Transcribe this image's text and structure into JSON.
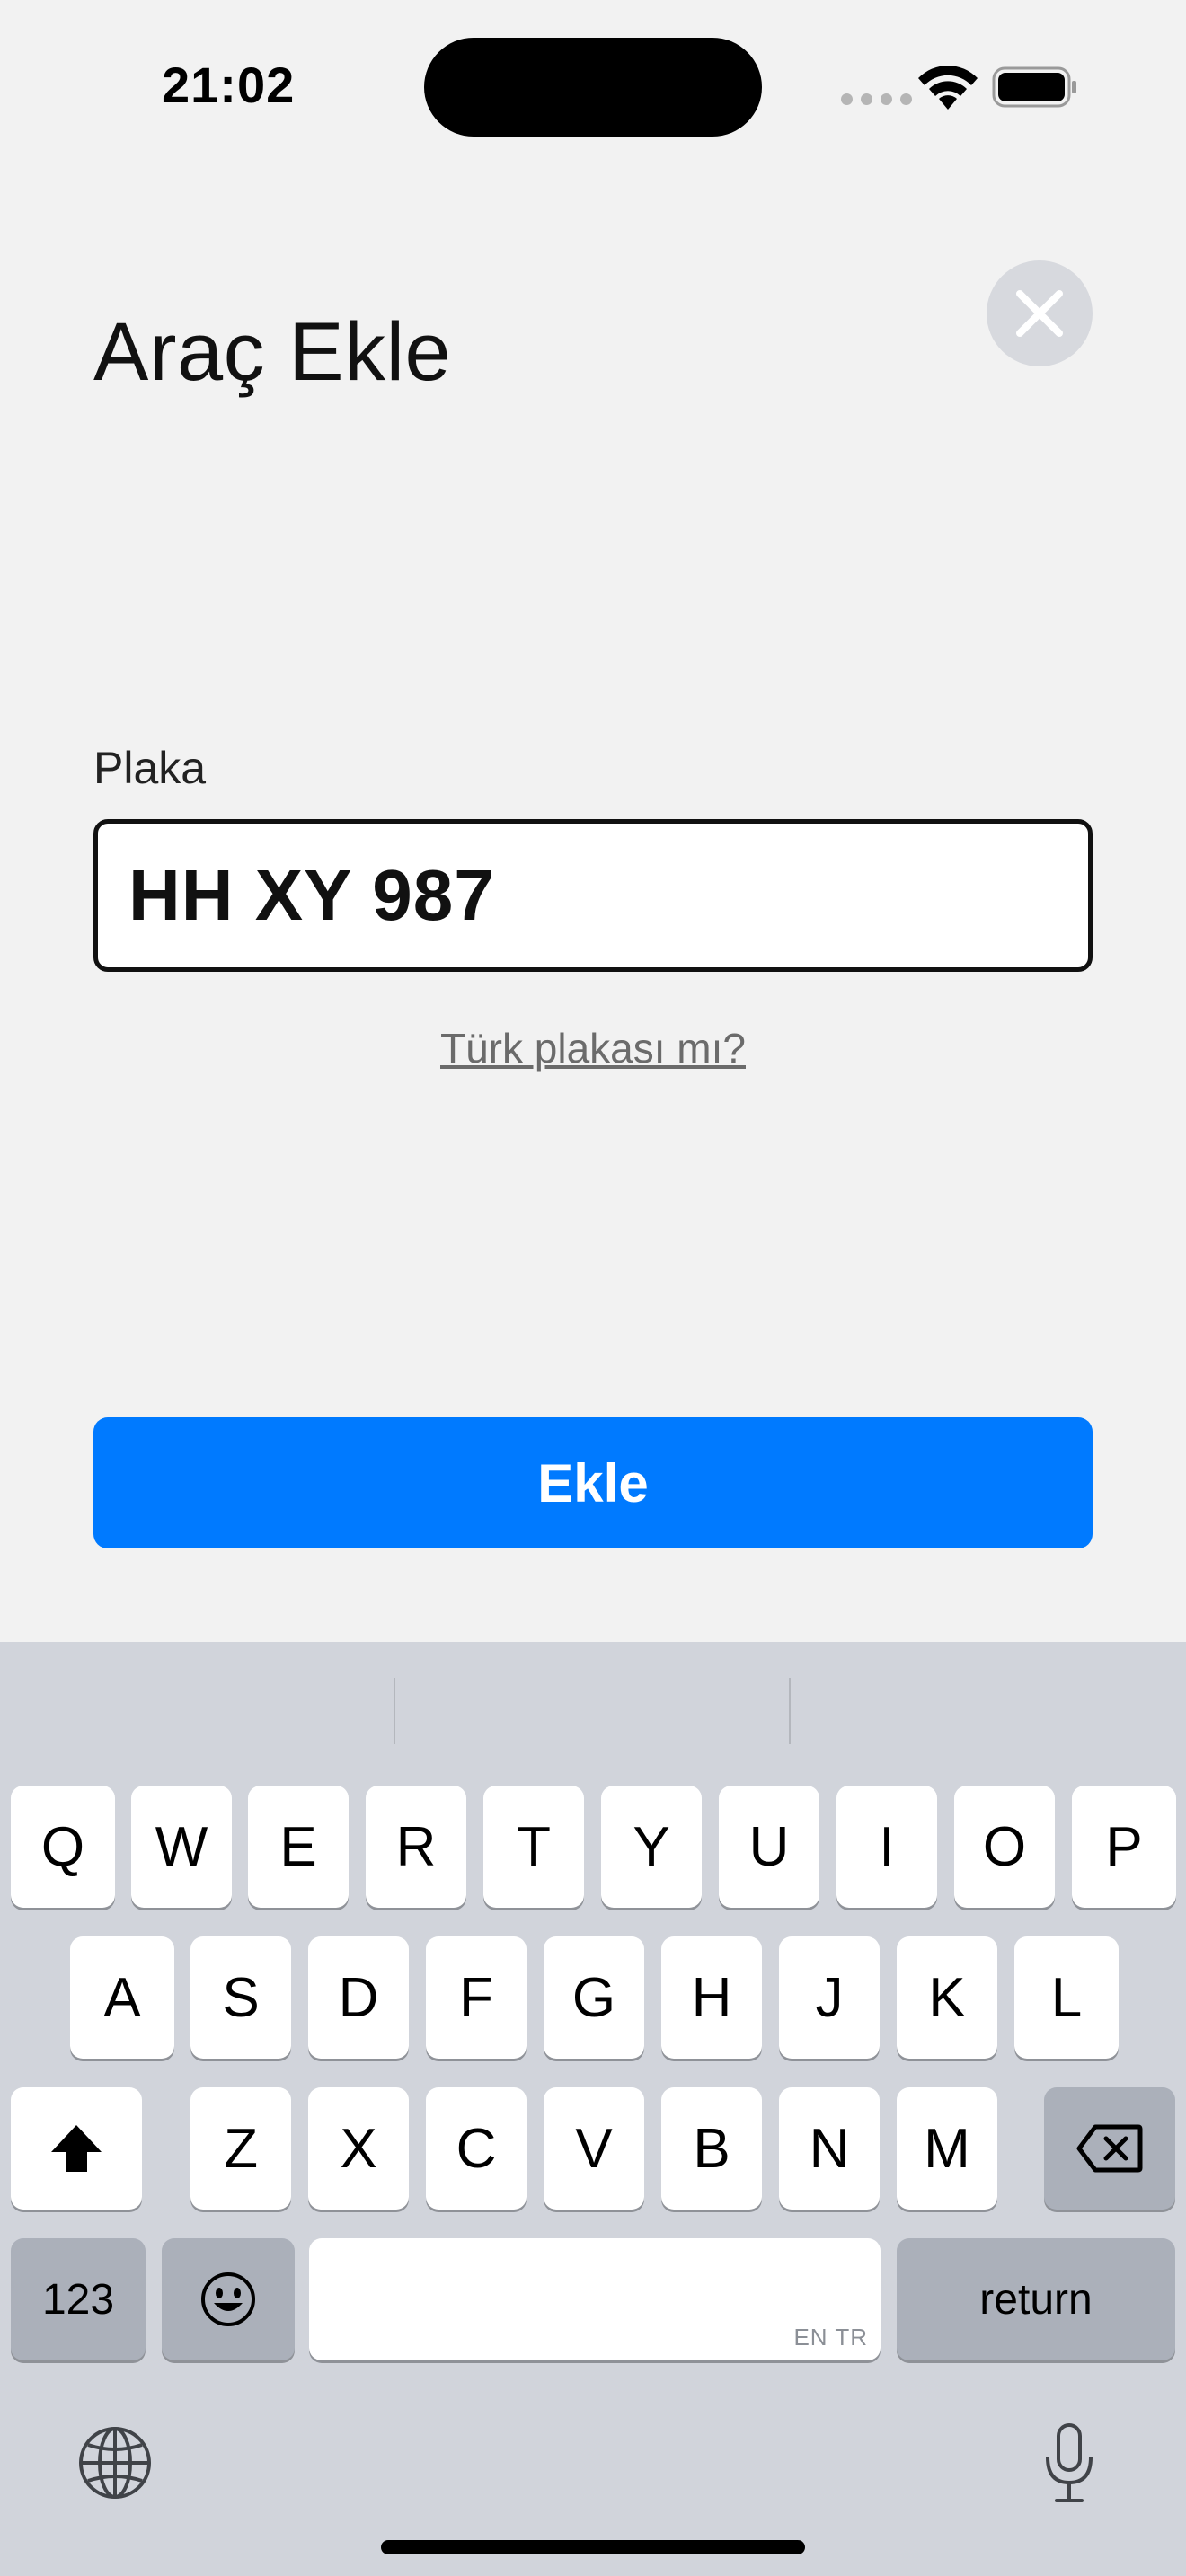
{
  "status_bar": {
    "time": "21:02",
    "signal_icon": "signal-bars-icon",
    "wifi_icon": "wifi-icon",
    "battery_icon": "battery-icon"
  },
  "header": {
    "title": "Araç Ekle",
    "close_icon": "close-icon"
  },
  "form": {
    "plate_label": "Plaka",
    "plate_value": "HH XY 987",
    "turk_link": "Türk plakası mı?",
    "add_button": "Ekle"
  },
  "colors": {
    "accent": "#007aff",
    "background": "#f2f2f2",
    "keyboard_bg": "#d1d4db"
  },
  "keyboard": {
    "row1": [
      "Q",
      "W",
      "E",
      "R",
      "T",
      "Y",
      "U",
      "I",
      "O",
      "P"
    ],
    "row2": [
      "A",
      "S",
      "D",
      "F",
      "G",
      "H",
      "J",
      "K",
      "L"
    ],
    "row3": [
      "Z",
      "X",
      "C",
      "V",
      "B",
      "N",
      "M"
    ],
    "numbers_key": "123",
    "return_key": "return",
    "space_languages": "EN TR",
    "shift_icon": "shift-icon",
    "delete_icon": "delete-icon",
    "emoji_icon": "emoji-icon",
    "globe_icon": "globe-icon",
    "mic_icon": "microphone-icon"
  }
}
